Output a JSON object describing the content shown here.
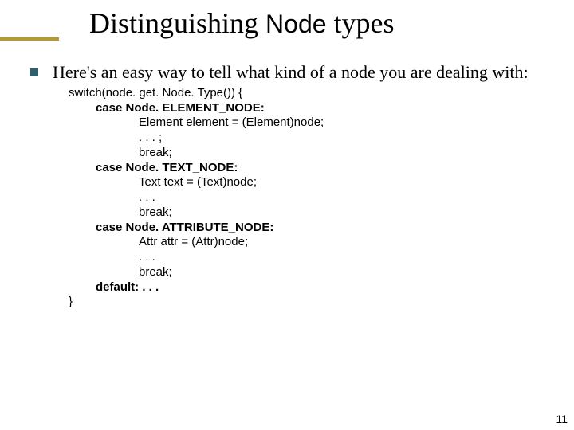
{
  "title": {
    "w1": "Distinguishing",
    "w2": "Node",
    "w3": "types"
  },
  "lead": "Here's an easy way to tell what kind of a node you are dealing with:",
  "code": {
    "switch_open": "switch(node. get. Node. Type()) {",
    "case1": "case Node. ELEMENT_NODE:",
    "c1a": "Element element = (Element)node;",
    "c1b": ". . . ;",
    "c1c": "break;",
    "case2": "case Node. TEXT_NODE:",
    "c2a": "Text text = (Text)node;",
    "c2b": ". . .",
    "c2c": "break;",
    "case3": "case Node. ATTRIBUTE_NODE:",
    "c3a": "Attr attr = (Attr)node;",
    "c3b": ". . .",
    "c3c": "break;",
    "default": "default: . . .",
    "switch_close": "}"
  },
  "slideNumber": "11"
}
